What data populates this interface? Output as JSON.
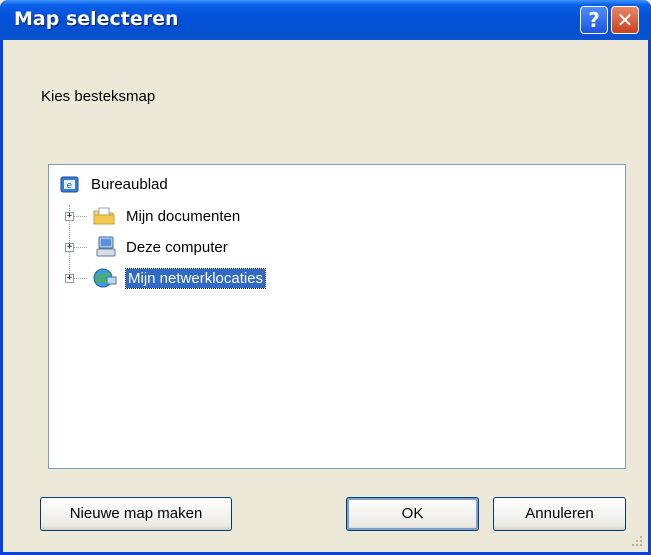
{
  "window": {
    "title": "Map selecteren"
  },
  "titlebar": {
    "help_glyph": "?",
    "close_glyph": "✕"
  },
  "prompt": "Kies besteksmap",
  "tree": {
    "root": {
      "label": "Bureaublad",
      "icon": "desktop-icon"
    },
    "items": [
      {
        "label": "Mijn documenten",
        "icon": "my-documents-folder-icon",
        "expander": "+",
        "selected": false
      },
      {
        "label": "Deze computer",
        "icon": "my-computer-icon",
        "expander": "+",
        "selected": false
      },
      {
        "label": "Mijn netwerklocaties",
        "icon": "network-places-icon",
        "expander": "+",
        "selected": true
      }
    ]
  },
  "buttons": {
    "new_folder": "Nieuwe map maken",
    "ok": "OK",
    "cancel": "Annuleren"
  },
  "colors": {
    "titlebar": "#0450D8",
    "selection": "#316AC5",
    "dialog_bg": "#ECE9D8"
  }
}
